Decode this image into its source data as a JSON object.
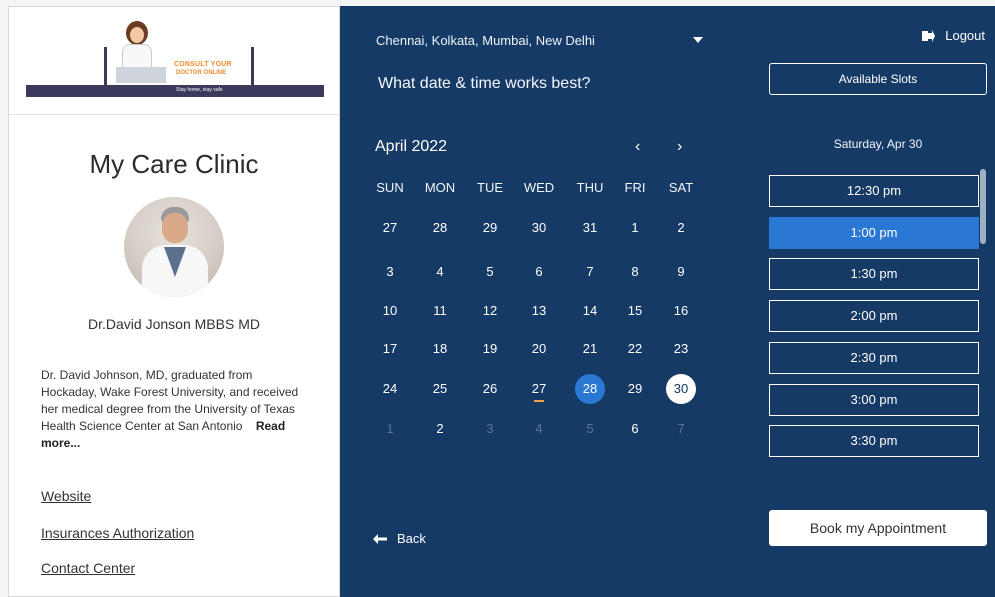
{
  "banner": {
    "line1": "CONSULT YOUR",
    "line2": "DOCTOR ONLINE",
    "line3": "Stay home, stay safe"
  },
  "clinic": {
    "name": "My Care Clinic",
    "doctor_name": "Dr.David Jonson MBBS MD",
    "bio": "Dr. David Johnson, MD, graduated from Hockaday, Wake Forest University, and received her medical degree from the University of Texas Health Science Center at San Antonio",
    "read_more": "Read more...",
    "links": [
      "Website",
      "Insurances Authorization",
      "Contact Center"
    ]
  },
  "header": {
    "locations": "Chennai, Kolkata, Mumbai, New Delhi",
    "logout": "Logout",
    "question": "What date & time works best?",
    "available_slots": "Available Slots"
  },
  "calendar": {
    "month": "April 2022",
    "prev": "‹",
    "next": "›",
    "weekdays": [
      "SUN",
      "MON",
      "TUE",
      "WED",
      "THU",
      "FRI",
      "SAT"
    ],
    "weeks": [
      [
        "27",
        "28",
        "29",
        "30",
        "31",
        "1",
        "2"
      ],
      [
        "3",
        "4",
        "5",
        "6",
        "7",
        "8",
        "9"
      ],
      [
        "10",
        "11",
        "12",
        "13",
        "14",
        "15",
        "16"
      ],
      [
        "17",
        "18",
        "19",
        "20",
        "21",
        "22",
        "23"
      ],
      [
        "24",
        "25",
        "26",
        "27",
        "28",
        "29",
        "30"
      ],
      [
        "1",
        "2",
        "3",
        "4",
        "5",
        "6",
        "7"
      ]
    ],
    "selected": "28",
    "highlighted": "30",
    "underlined": "27"
  },
  "slots": {
    "date": "Saturday, Apr 30",
    "times": [
      "12:30 pm",
      "1:00 pm",
      "1:30 pm",
      "2:00 pm",
      "2:30 pm",
      "3:00 pm",
      "3:30 pm"
    ],
    "active": "1:00 pm"
  },
  "footer": {
    "back": "Back",
    "book": "Book my Appointment"
  },
  "colors": {
    "panel": "#163a66",
    "accent": "#2b78d4",
    "underline": "#f0a24a"
  },
  "icons": [
    "logout-icon",
    "chevron-down-icon",
    "arrow-left-icon",
    "chevron-left-icon",
    "chevron-right-icon"
  ]
}
